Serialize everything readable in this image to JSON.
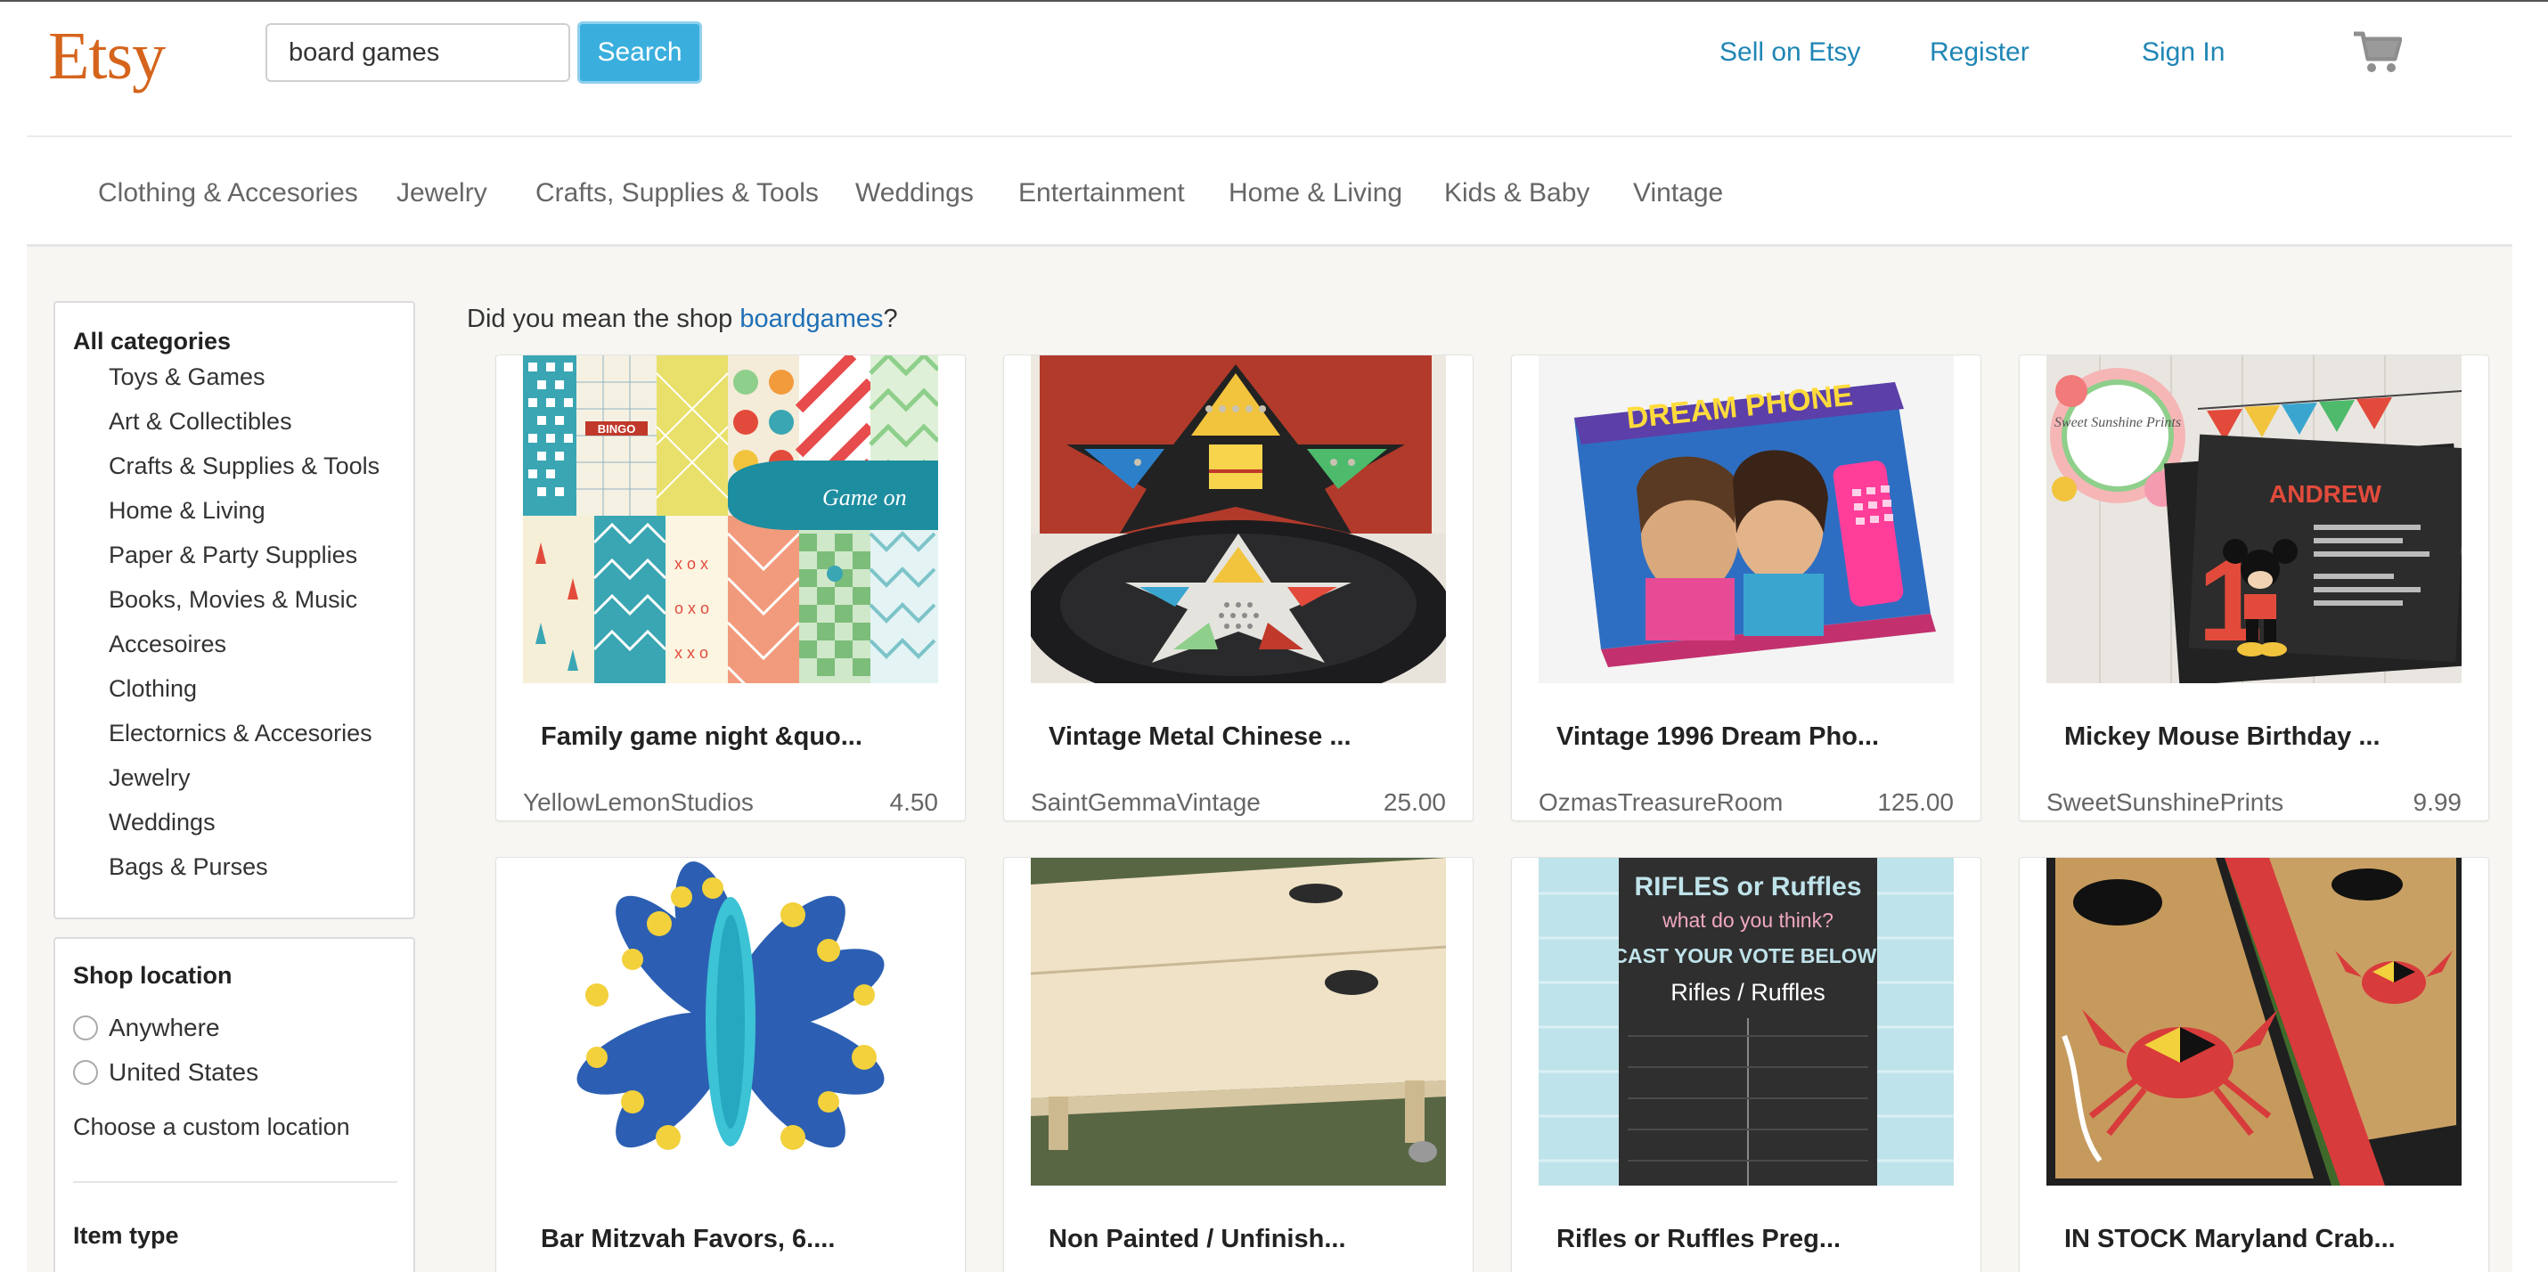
{
  "header": {
    "logo": "Etsy",
    "search_value": "board games",
    "search_button": "Search",
    "links": [
      "Sell on Etsy",
      "Register",
      "Sign In"
    ]
  },
  "nav": {
    "categories": [
      "Clothing & Accesories",
      "Jewelry",
      "Crafts, Supplies & Tools",
      "Weddings",
      "Entertainment",
      "Home & Living",
      "Kids & Baby",
      "Vintage"
    ]
  },
  "sidebar": {
    "all_categories": "All categories",
    "categories": [
      "Toys & Games",
      "Art & Collectibles",
      "Crafts & Supplies & Tools",
      "Home & Living",
      "Paper & Party Supplies",
      "Books, Movies & Music",
      "Accesoires",
      "Clothing",
      "Electornics & Accesories",
      "Jewelry",
      "Weddings",
      "Bags & Purses"
    ],
    "shop_location": "Shop location",
    "locations": [
      "Anywhere",
      "United States"
    ],
    "custom_location": "Choose a custom location",
    "item_type": "Item type"
  },
  "suggestion": {
    "prefix": "Did you mean the shop ",
    "link": "boardgames",
    "suffix": "?"
  },
  "listings": [
    {
      "title": "Family game night &quo...",
      "shop": "YellowLemonStudios",
      "price": "4.50"
    },
    {
      "title": "Vintage Metal Chinese ...",
      "shop": "SaintGemmaVintage",
      "price": "25.00"
    },
    {
      "title": "Vintage 1996 Dream Pho...",
      "shop": "OzmasTreasureRoom",
      "price": "125.00"
    },
    {
      "title": "Mickey Mouse Birthday ...",
      "shop": "SweetSunshinePrints",
      "price": "9.99"
    },
    {
      "title": "Bar Mitzvah Favors, 6....",
      "shop": "",
      "price": ""
    },
    {
      "title": "Non Painted / Unfinish...",
      "shop": "",
      "price": ""
    },
    {
      "title": "Rifles or Ruffles Preg...",
      "shop": "",
      "price": ""
    },
    {
      "title": "IN STOCK Maryland Crab...",
      "shop": "",
      "price": ""
    }
  ],
  "image_text": {
    "game_on": "Game on",
    "bingo": "BINGO",
    "dream_phone": "DREAM PHONE",
    "sweet_sunshine": "Sweet Sunshine Prints",
    "andrew": "ANDREW",
    "one": "1",
    "rifles_line1": "RIFLES or Ruffles",
    "rifles_line2": "what do you think?",
    "rifles_line3": "CAST YOUR VOTE BELOW:",
    "rifles_line4": "Rifles / Ruffles"
  }
}
